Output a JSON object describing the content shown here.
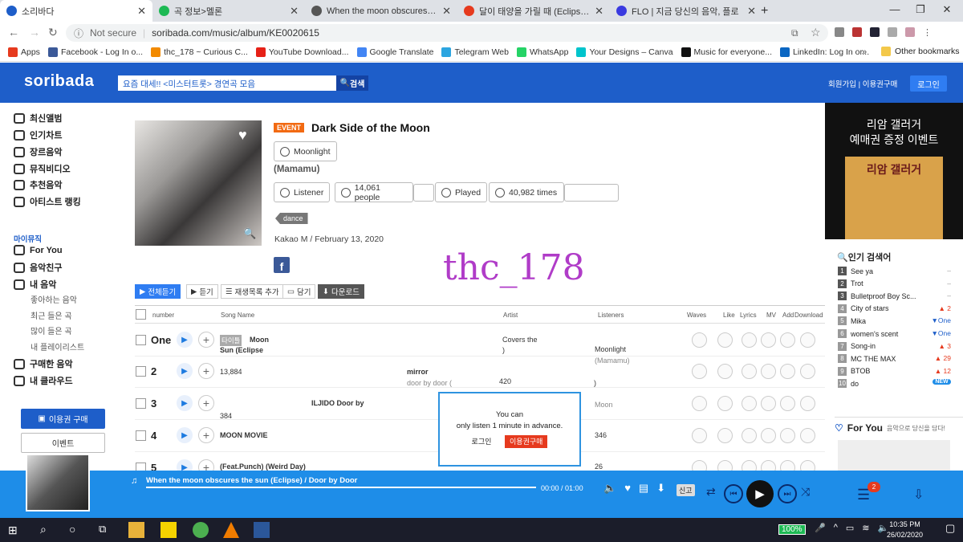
{
  "browser": {
    "tabs": [
      {
        "title": "소리바다",
        "active": true,
        "color": "#1e5ec9"
      },
      {
        "title": "곡 정보>멜론",
        "active": false,
        "color": "#1db954"
      },
      {
        "title": "When the moon obscures the sun",
        "active": false,
        "color": "#555"
      },
      {
        "title": "달이 태양을 가릴 때 (Eclipse)/문",
        "active": false,
        "color": "#e63a1e"
      },
      {
        "title": "FLO | 지금 당신의 음악, 플로",
        "active": false,
        "color": "#3a3ae0"
      }
    ],
    "security": "Not secure",
    "url": "soribada.com/music/album/KE0020615",
    "bookmarks": [
      {
        "label": "Apps",
        "color": "#e63a1e"
      },
      {
        "label": "Facebook - Log In o...",
        "color": "#3b5998"
      },
      {
        "label": "thc_178 ~ Curious C...",
        "color": "#f28a00"
      },
      {
        "label": "YouTube Download...",
        "color": "#e62117"
      },
      {
        "label": "Google Translate",
        "color": "#4285f4"
      },
      {
        "label": "Telegram Web",
        "color": "#2ca5e0"
      },
      {
        "label": "WhatsApp",
        "color": "#25d366"
      },
      {
        "label": "Your Designs – Canva",
        "color": "#00c4cc"
      },
      {
        "label": "Music for everyone...",
        "color": "#111"
      },
      {
        "label": "LinkedIn: Log In or...",
        "color": "#0a66c2"
      }
    ],
    "more": "»",
    "other_bookmarks": "Other bookmarks"
  },
  "site": {
    "logo": "soribada",
    "search_value": "요즘 대세!! <미스터트롯> 경연곡 모음",
    "search_btn": "검색",
    "header_links": "회원가입  |  이용권구매",
    "login": "로그인"
  },
  "sidebar": {
    "nav": [
      {
        "label": "최신앨범",
        "icon": "disc-icon"
      },
      {
        "label": "인기차트",
        "icon": "chart-icon"
      },
      {
        "label": "장르음악",
        "icon": "genre-icon"
      },
      {
        "label": "뮤직비디오",
        "icon": "video-icon"
      },
      {
        "label": "추천음악",
        "icon": "note-icon"
      },
      {
        "label": "아티스트 랭킹",
        "icon": "person-icon"
      }
    ],
    "my_music": "마이뮤직",
    "my_items": [
      {
        "label": "For You",
        "icon": "heart-icon"
      },
      {
        "label": "음악친구",
        "icon": "friends-icon"
      },
      {
        "label": "내 음악",
        "icon": "list-icon"
      }
    ],
    "sub_items": [
      "좋아하는 음악",
      "최근 들은 곡",
      "많이 들은 곡",
      "내 플레이리스트"
    ],
    "bottom_items": [
      {
        "label": "구매한 음악",
        "icon": "cart-icon"
      },
      {
        "label": "내 클라우드",
        "icon": "cloud-icon"
      }
    ],
    "buy_btn": "이용권 구매",
    "event_btn": "이벤트"
  },
  "album": {
    "event": "EVENT",
    "title": "Dark Side of the Moon",
    "artist_btn": "Moonlight",
    "artist_paren": "(Mamamu)",
    "listener_label": "Listener",
    "listener_count": "14,061 people",
    "played_label": "Played",
    "played_count": "40,982 times",
    "genre": "dance",
    "label_date": "Kakao M / February 13, 2020",
    "watermark": "thc_178"
  },
  "toolbar": {
    "play_all": "전체듣기",
    "listen": "듣기",
    "add_playlist": "재생목록 추가",
    "save": "담기",
    "download": "다운로드"
  },
  "table": {
    "headers": [
      "number",
      "Song Name",
      "Artist",
      "Listeners",
      "Waves",
      "Like",
      "Lyrics",
      "MV",
      "Add",
      "Download"
    ],
    "rows": [
      {
        "num": "One",
        "badge": "타이틀",
        "a": "Moon",
        "b": "Sun (Eclipse",
        "c": "Covers the",
        "d": ")",
        "e": "Moonlight",
        "f": "(Mamamu)"
      },
      {
        "num": "2",
        "a": "13,884",
        "b": "mirror",
        "c": "door by door (",
        "d": "420",
        "e": ")"
      },
      {
        "num": "3",
        "a": "ILJIDO Door by",
        "b": "384",
        "c": "Moon"
      },
      {
        "num": "4",
        "a": "MOON MOVIE",
        "b": "346"
      },
      {
        "num": "5",
        "a": "(Feat.Punch) (Weird Day)",
        "b": "26"
      }
    ]
  },
  "popup": {
    "line1": "You can",
    "line2": "only listen 1 minute in advance.",
    "login": "로그인",
    "buy": "이용권구매"
  },
  "ad": {
    "line1": "리암 갤러거",
    "line2": "예매권 증정 이벤트",
    "poster": "리암 갤러거"
  },
  "popular": {
    "title": "인기 검색어",
    "items": [
      {
        "rank": "1",
        "name": "See ya",
        "change": "–",
        "color": "#999"
      },
      {
        "rank": "2",
        "name": "Trot",
        "change": "–",
        "color": "#999"
      },
      {
        "rank": "3",
        "name": "Bulletproof Boy Sc...",
        "change": "–",
        "color": "#999"
      },
      {
        "rank": "4",
        "name": "City of stars",
        "change": "▲ 2",
        "color": "#e63a1e"
      },
      {
        "rank": "5",
        "name": "Mika",
        "change": "▼One",
        "color": "#1e5ec9"
      },
      {
        "rank": "6",
        "name": "women's scent",
        "change": "▼One",
        "color": "#1e5ec9"
      },
      {
        "rank": "7",
        "name": "Song-in",
        "change": "▲ 3",
        "color": "#e63a1e"
      },
      {
        "rank": "8",
        "name": "MC THE MAX",
        "change": "▲ 29",
        "color": "#e63a1e"
      },
      {
        "rank": "9",
        "name": "BTOB",
        "change": "▲ 12",
        "color": "#e63a1e"
      },
      {
        "rank": "10",
        "name": "do",
        "change": "NEW",
        "color": "#1e8de8"
      }
    ],
    "foryou": "For You",
    "foryou_sub": "음악으로 당신을 담다!"
  },
  "player": {
    "title": "When the moon obscures the sun (Eclipse) / Door by Door",
    "time": "00:00",
    "duration": "/ 01:00",
    "progress": 0,
    "report": "신고",
    "badge": "2"
  },
  "taskbar": {
    "battery": "100%",
    "time": "10:35 PM",
    "date": "26/02/2020"
  }
}
